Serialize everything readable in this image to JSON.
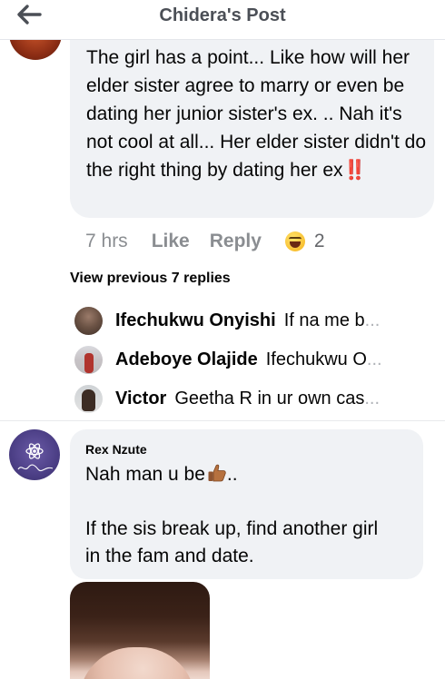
{
  "header": {
    "title": "Chidera's Post",
    "back_icon": "arrow-left-icon"
  },
  "main_comment": {
    "text": "The girl has a point... Like how will her elder sister agree to marry or even be dating her junior sister's ex. .. Nah it's not cool at all... Her elder sister didn't do the right thing by dating her ex",
    "emoji_trailing": "‼️",
    "time": "7 hrs",
    "like_label": "Like",
    "reply_label": "Reply",
    "reaction_icon": "laughing-face-emoji",
    "reaction_count": "2"
  },
  "view_previous": "View previous 7 replies",
  "replies": [
    {
      "name": "Ifechukwu Onyishi",
      "snippet": "If na me b",
      "ellipsis": "..."
    },
    {
      "name": "Adeboye Olajide",
      "snippet": "Ifechukwu O",
      "ellipsis": "..."
    },
    {
      "name": "Victor",
      "snippet": "Geetha R in ur own cas",
      "ellipsis": "..."
    }
  ],
  "comment2": {
    "author": "Rex Nzute",
    "line1": "Nah man u be",
    "line1_suffix": "..",
    "line2": "If the sis break up, find another girl",
    "line3": "in the fam and date."
  },
  "colors": {
    "bubble": "#f0f2f5",
    "meta_text": "#8a8d91",
    "header_text": "#4b4f56",
    "alert_red": "#e0202c"
  }
}
